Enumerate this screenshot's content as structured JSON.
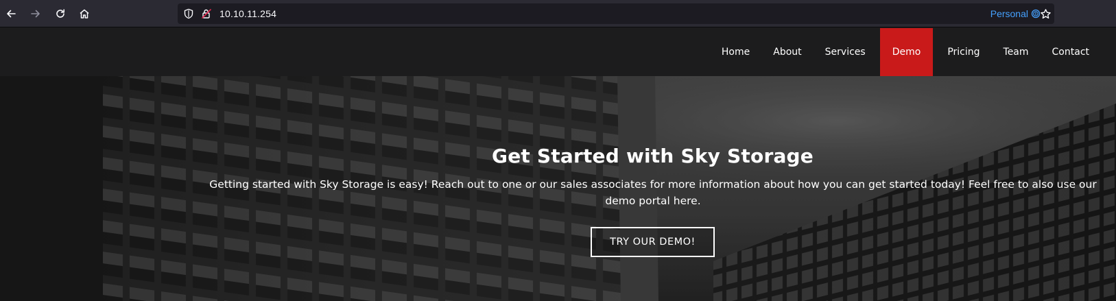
{
  "browser": {
    "url": "10.10.11.254",
    "container_label": "Personal",
    "container_color": "#45a1ff"
  },
  "nav": {
    "items": [
      {
        "label": "Home",
        "active": false
      },
      {
        "label": "About",
        "active": false
      },
      {
        "label": "Services",
        "active": false
      },
      {
        "label": "Demo",
        "active": true
      },
      {
        "label": "Pricing",
        "active": false
      },
      {
        "label": "Team",
        "active": false
      },
      {
        "label": "Contact",
        "active": false
      }
    ],
    "active_color": "#c91a1a"
  },
  "hero": {
    "title": "Get Started with Sky Storage",
    "text": "Getting started with Sky Storage is easy! Reach out to one or our sales associates for more information about how you can get started today! Feel free to also use our demo portal here.",
    "button_label": "TRY OUR DEMO!"
  }
}
